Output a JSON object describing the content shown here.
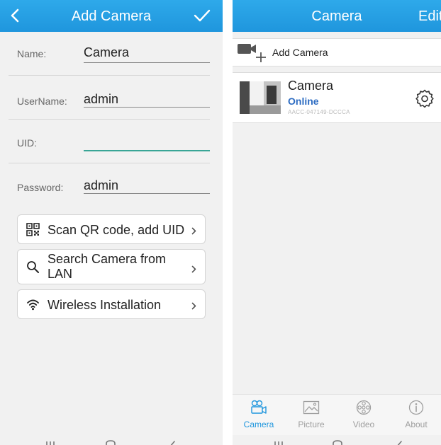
{
  "left_screen": {
    "header": {
      "title": "Add Camera"
    },
    "fields": [
      {
        "label": "Name:",
        "value": "Camera"
      },
      {
        "label": "UserName:",
        "value": "admin"
      },
      {
        "label": "UID:",
        "value": ""
      },
      {
        "label": "Password:",
        "value": "admin"
      }
    ],
    "options": [
      {
        "label": "Scan QR code, add UID",
        "icon": "qr-code-icon"
      },
      {
        "label": "Search Camera from LAN",
        "icon": "search-icon"
      },
      {
        "label": "Wireless Installation",
        "icon": "wifi-icon"
      }
    ]
  },
  "right_screen": {
    "header": {
      "title": "Camera",
      "edit_label": "Edit"
    },
    "add_camera_label": "Add Camera",
    "camera": {
      "name": "Camera",
      "status": "Online",
      "uid": "AACC-047149-DCCCA"
    },
    "tabs": [
      {
        "label": "Camera",
        "icon": "camera-tab-icon",
        "active": true
      },
      {
        "label": "Picture",
        "icon": "picture-tab-icon",
        "active": false
      },
      {
        "label": "Video",
        "icon": "video-tab-icon",
        "active": false
      },
      {
        "label": "About",
        "icon": "about-tab-icon",
        "active": false
      }
    ]
  },
  "colors": {
    "header_blue": "#1f96dd",
    "active_underline": "#39a596",
    "online_blue": "#2d6cc2",
    "active_tab_blue": "#1f96dd",
    "background": "#f1f1f1"
  }
}
